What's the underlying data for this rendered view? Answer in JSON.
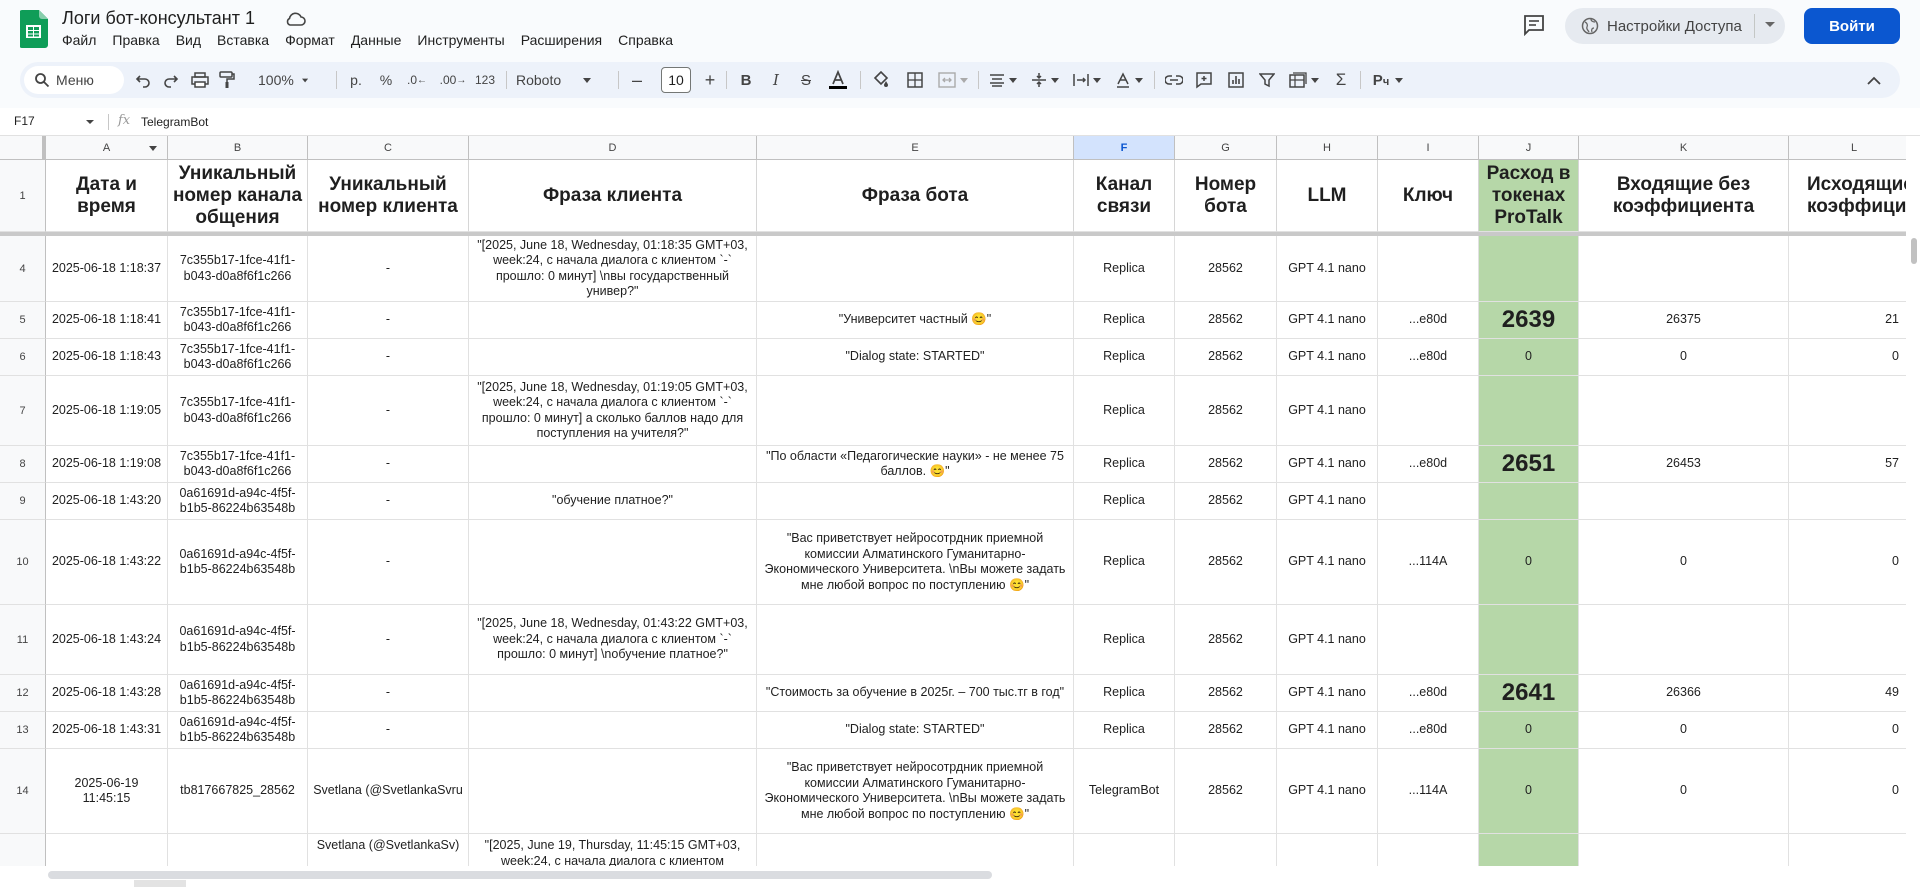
{
  "header": {
    "title": "Логи бот-консультант 1",
    "menu": [
      "Файл",
      "Правка",
      "Вид",
      "Вставка",
      "Формат",
      "Данные",
      "Инструменты",
      "Расширения",
      "Справка"
    ],
    "share_label": "Настройки Доступа",
    "login_label": "Войти"
  },
  "toolbar": {
    "search_label": "Меню",
    "zoom": "100%",
    "currency": "р.",
    "percent": "%",
    "dec_decrease": ".0",
    "dec_increase": ".00",
    "format_123": "123",
    "font": "Roboto",
    "font_size": "10"
  },
  "formula_bar": {
    "name_box": "F17",
    "fx": "fx",
    "value": "TelegramBot"
  },
  "colors": {
    "accent": "#0b57d0",
    "green_col": "#b6d7a8",
    "selected_col": "#d3e3fd"
  },
  "columns": [
    "A",
    "B",
    "C",
    "D",
    "E",
    "F",
    "G",
    "H",
    "I",
    "J",
    "K",
    "L"
  ],
  "header_row": {
    "num": "1",
    "cells": [
      "Дата и время",
      "Уникальный номер канала общения",
      "Уникальный номер клиента",
      "Фраза клиента",
      "Фраза бота",
      "Канал связи",
      "Номер бота",
      "LLM",
      "Ключ",
      "Расход в токенах ProTalk",
      "Входящие без коэффициента",
      "Исходящие коэффици"
    ]
  },
  "rows": [
    {
      "num": "4",
      "cells": [
        "2025-06-18 1:18:37",
        "7c355b17-1fce-41f1-b043-d0a8f6f1c266",
        "-",
        "\"[2025, June 18, Wednesday, 01:18:35 GMT+03, week:24, с начала диалога с клиентом `-` прошло: 0 минут] \\nвы государственный универ?\"",
        "",
        "Replica",
        "28562",
        "GPT 4.1 nano",
        "",
        "",
        "",
        ""
      ]
    },
    {
      "num": "5",
      "cells": [
        "2025-06-18 1:18:41",
        "7c355b17-1fce-41f1-b043-d0a8f6f1c266",
        "-",
        "",
        "\"Университет частный 😊\"",
        "Replica",
        "28562",
        "GPT 4.1 nano",
        "...e80d",
        "2639",
        "26375",
        "21"
      ]
    },
    {
      "num": "6",
      "cells": [
        "2025-06-18 1:18:43",
        "7c355b17-1fce-41f1-b043-d0a8f6f1c266",
        "-",
        "",
        "\"Dialog state: STARTED\"",
        "Replica",
        "28562",
        "GPT 4.1 nano",
        "...e80d",
        "0",
        "0",
        "0"
      ]
    },
    {
      "num": "7",
      "cells": [
        "2025-06-18 1:19:05",
        "7c355b17-1fce-41f1-b043-d0a8f6f1c266",
        "-",
        "\"[2025, June 18, Wednesday, 01:19:05 GMT+03, week:24, с начала диалога с клиентом `-` прошло: 0 минут] а сколько баллов надо для поступления на учителя?\"",
        "",
        "Replica",
        "28562",
        "GPT 4.1 nano",
        "",
        "",
        "",
        ""
      ]
    },
    {
      "num": "8",
      "cells": [
        "2025-06-18 1:19:08",
        "7c355b17-1fce-41f1-b043-d0a8f6f1c266",
        "-",
        "",
        "\"По области «Педагогические науки» - не менее 75 баллов. 😊\"",
        "Replica",
        "28562",
        "GPT 4.1 nano",
        "...e80d",
        "2651",
        "26453",
        "57"
      ]
    },
    {
      "num": "9",
      "cells": [
        "2025-06-18 1:43:20",
        "0a61691d-a94c-4f5f-b1b5-86224b63548b",
        "-",
        "\"обучение платное?\"",
        "",
        "Replica",
        "28562",
        "GPT 4.1 nano",
        "",
        "",
        "",
        ""
      ]
    },
    {
      "num": "10",
      "cells": [
        "2025-06-18 1:43:22",
        "0a61691d-a94c-4f5f-b1b5-86224b63548b",
        "-",
        "",
        "\"Вас приветствует нейросотрдник приемной комиссии Алматинского Гуманитарно-Экономического Университета. \\nВы можете задать мне любой вопрос по поступлению 😊\"",
        "Replica",
        "28562",
        "GPT 4.1 nano",
        "...114A",
        "0",
        "0",
        "0"
      ]
    },
    {
      "num": "11",
      "cells": [
        "2025-06-18 1:43:24",
        "0a61691d-a94c-4f5f-b1b5-86224b63548b",
        "-",
        "\"[2025, June 18, Wednesday, 01:43:22 GMT+03, week:24, с начала диалога с клиентом `-` прошло: 0 минут] \\nобучение платное?\"",
        "",
        "Replica",
        "28562",
        "GPT 4.1 nano",
        "",
        "",
        "",
        ""
      ]
    },
    {
      "num": "12",
      "cells": [
        "2025-06-18 1:43:28",
        "0a61691d-a94c-4f5f-b1b5-86224b63548b",
        "-",
        "",
        "\"Стоимость за обучение в 2025г. – 700 тыс.тг в год\"",
        "Replica",
        "28562",
        "GPT 4.1 nano",
        "...e80d",
        "2641",
        "26366",
        "49"
      ]
    },
    {
      "num": "13",
      "cells": [
        "2025-06-18 1:43:31",
        "0a61691d-a94c-4f5f-b1b5-86224b63548b",
        "-",
        "",
        "\"Dialog state: STARTED\"",
        "Replica",
        "28562",
        "GPT 4.1 nano",
        "...e80d",
        "0",
        "0",
        "0"
      ]
    },
    {
      "num": "14",
      "cells": [
        "2025-06-19 11:45:15",
        "tb817667825_28562",
        "Svetlana (@SvetlankaSvru",
        "",
        "\"Вас приветствует нейросотрдник приемной комиссии Алматинского Гуманитарно-Экономического Университета. \\nВы можете задать мне любой вопрос по поступлению 😊\"",
        "TelegramBot",
        "28562",
        "GPT 4.1 nano",
        "...114A",
        "0",
        "0",
        "0"
      ]
    },
    {
      "num": "",
      "cells": [
        "",
        "",
        "Svetlana (@SvetlankaSv)",
        "\"[2025, June 19, Thursday, 11:45:15 GMT+03, week:24, с начала диалога с клиентом",
        "",
        "",
        "",
        "",
        "",
        "",
        "",
        ""
      ]
    }
  ]
}
